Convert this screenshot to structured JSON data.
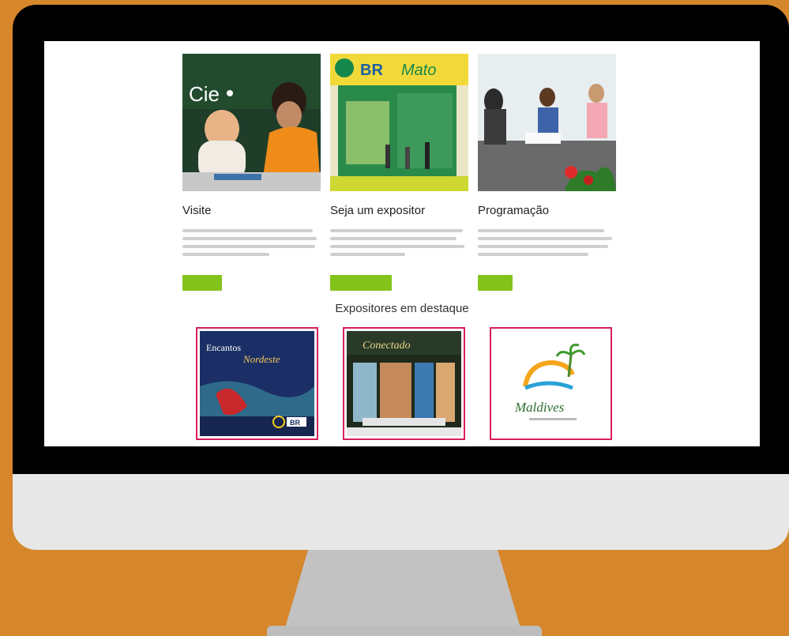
{
  "cards": [
    {
      "title": "Visite",
      "button": ""
    },
    {
      "title": "Seja um expositor",
      "button": ""
    },
    {
      "title": "Programação",
      "button": ""
    }
  ],
  "section_title": "Expositores em destaque",
  "featured": [
    {
      "title": "Encantos",
      "subtitle": "Nordeste",
      "logo": "BR"
    },
    {
      "title": "Conectado",
      "subtitle": ""
    },
    {
      "title": "Maldives",
      "subtitle": ""
    }
  ],
  "colors": {
    "background": "#d6862b",
    "button": "#84c31a",
    "feature_border": "#d81e5b"
  }
}
